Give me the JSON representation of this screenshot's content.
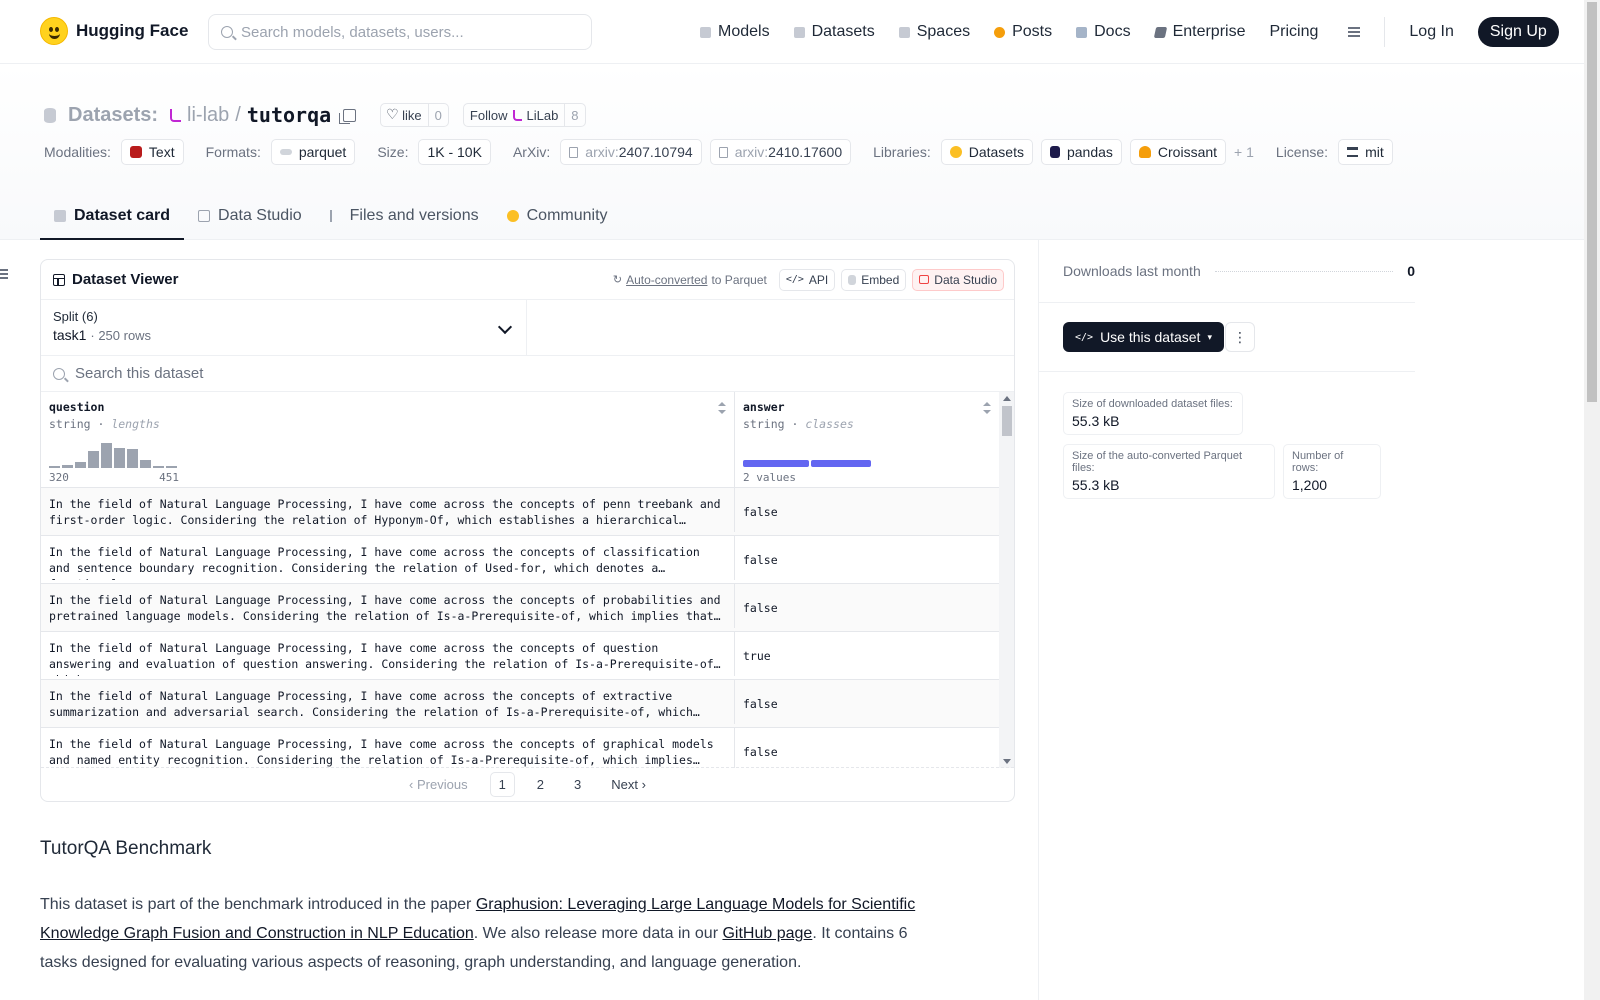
{
  "nav": {
    "brand": "Hugging Face",
    "search_placeholder": "Search models, datasets, users...",
    "links": [
      "Models",
      "Datasets",
      "Spaces",
      "Posts",
      "Docs",
      "Enterprise",
      "Pricing"
    ],
    "login": "Log In",
    "signup": "Sign Up"
  },
  "header": {
    "section": "Datasets:",
    "org": "li-lab",
    "name": "tutorqa",
    "like_label": "like",
    "like_count": "0",
    "follow_label": "Follow",
    "follow_org": "LiLab",
    "follow_count": "8",
    "modalities_label": "Modalities:",
    "modality": "Text",
    "formats_label": "Formats:",
    "format": "parquet",
    "size_label": "Size:",
    "size": "1K - 10K",
    "arxiv_label": "ArXiv:",
    "arxiv_prefix": "arxiv:",
    "arxiv": [
      "2407.10794",
      "2410.17600"
    ],
    "libraries_label": "Libraries:",
    "libraries": [
      "Datasets",
      "pandas",
      "Croissant"
    ],
    "libraries_more": "+ 1",
    "license_label": "License:",
    "license": "mit"
  },
  "tabs": [
    "Dataset card",
    "Data Studio",
    "Files and versions",
    "Community"
  ],
  "viewer": {
    "title": "Dataset Viewer",
    "auto_converted": "Auto-converted",
    "to_parquet": "to Parquet",
    "api": "API",
    "embed": "Embed",
    "data_studio": "Data Studio",
    "split_label": "Split (6)",
    "split_name": "task1",
    "split_rows": "250 rows",
    "search_placeholder": "Search this dataset",
    "columns": [
      {
        "name": "question",
        "type": "string",
        "stat": "lengths",
        "min": "320",
        "max": "451"
      },
      {
        "name": "answer",
        "type": "string",
        "stat": "classes",
        "summary": "2 values"
      }
    ],
    "histogram": [
      0.05,
      0.12,
      0.22,
      0.6,
      0.88,
      0.72,
      0.68,
      0.3,
      0.08,
      0.05
    ],
    "class_split": [
      0.52,
      0.48
    ],
    "rows": [
      {
        "question": "In the field of Natural Language Processing, I have come across the concepts of penn treebank and first-order logic. Considering the relation of Hyponym-Of, which establishes a hierarchical…",
        "answer": "false"
      },
      {
        "question": "In the field of Natural Language Processing, I have come across the concepts of classification and sentence boundary recognition. Considering the relation of Used-for, which denotes a functional…",
        "answer": "false"
      },
      {
        "question": "In the field of Natural Language Processing, I have come across the concepts of probabilities and pretrained language models. Considering the relation of Is-a-Prerequisite-of, which implies that…",
        "answer": "false"
      },
      {
        "question": "In the field of Natural Language Processing, I have come across the concepts of question answering and evaluation of question answering. Considering the relation of Is-a-Prerequisite-of, which…",
        "answer": "true"
      },
      {
        "question": "In the field of Natural Language Processing, I have come across the concepts of extractive summarization and adversarial search. Considering the relation of Is-a-Prerequisite-of, which…",
        "answer": "false"
      },
      {
        "question": "In the field of Natural Language Processing, I have come across the concepts of graphical models and named entity recognition. Considering the relation of Is-a-Prerequisite-of, which implies tha…",
        "answer": "false"
      }
    ],
    "pager": {
      "prev": "Previous",
      "pages": [
        "1",
        "2",
        "3"
      ],
      "next": "Next"
    }
  },
  "readme": {
    "heading": "TutorQA Benchmark",
    "p_start": "This dataset is part of the benchmark introduced in the paper ",
    "paper_link": "Graphusion: Leveraging Large Language Models for Scientific Knowledge Graph Fusion and Construction in NLP Education",
    "p_mid": ". We also release more data in our ",
    "github_link": "GitHub page",
    "p_end": ". It contains 6 tasks designed for evaluating various aspects of reasoning, graph understanding, and language generation."
  },
  "sidebar": {
    "downloads_label": "Downloads last month",
    "downloads_value": "0",
    "use_button": "Use this dataset",
    "stats": [
      {
        "label": "Size of downloaded dataset files:",
        "value": "55.3 kB"
      },
      {
        "label": "Size of the auto-converted Parquet files:",
        "value": "55.3 kB"
      },
      {
        "label": "Number of rows:",
        "value": "1,200"
      }
    ]
  }
}
